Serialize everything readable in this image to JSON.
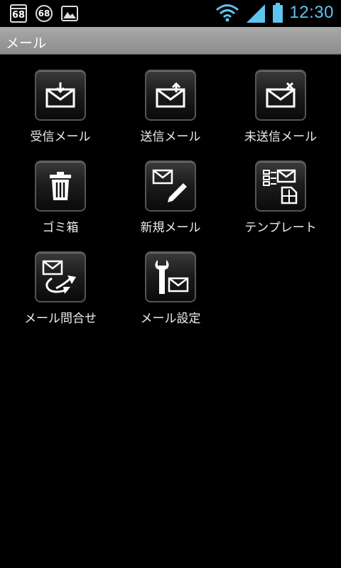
{
  "status_bar": {
    "calendar_number": "68",
    "notify_number": "68",
    "time": "12:30"
  },
  "title": "メール",
  "menu": {
    "items": [
      {
        "label": "受信メール",
        "icon": "mail-inbox-icon"
      },
      {
        "label": "送信メール",
        "icon": "mail-send-icon"
      },
      {
        "label": "未送信メール",
        "icon": "mail-unsent-icon"
      },
      {
        "label": "ゴミ箱",
        "icon": "trash-icon"
      },
      {
        "label": "新規メール",
        "icon": "mail-compose-icon"
      },
      {
        "label": "テンプレート",
        "icon": "template-icon"
      },
      {
        "label": "メール問合せ",
        "icon": "mail-inquiry-icon"
      },
      {
        "label": "メール設定",
        "icon": "mail-settings-icon"
      }
    ]
  },
  "colors": {
    "clock": "#5ec4f0",
    "titlebar": "#9a9a9a",
    "background": "#000000"
  }
}
